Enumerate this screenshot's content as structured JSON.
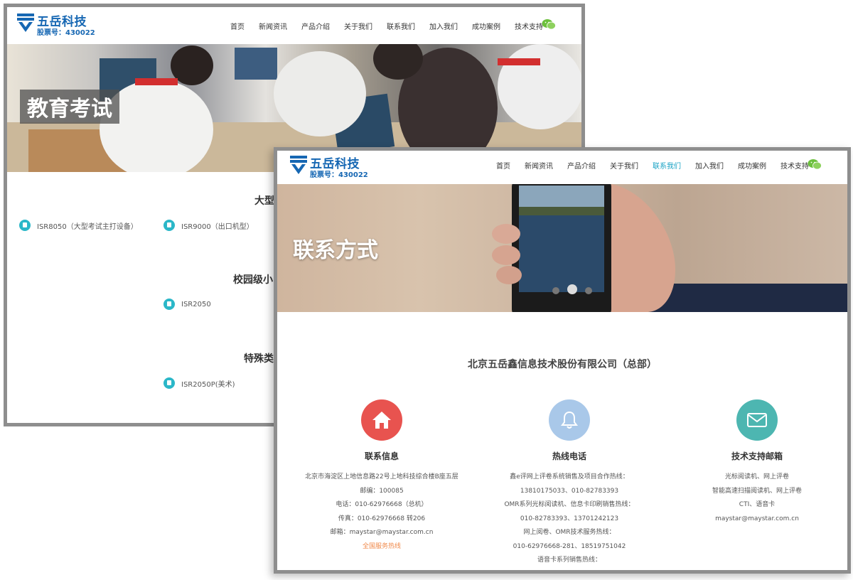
{
  "logo": {
    "name": "五岳科技",
    "stock": "股票号：430022"
  },
  "nav": [
    "首页",
    "新闻资讯",
    "产品介绍",
    "关于我们",
    "联系我们",
    "加入我们",
    "成功案例",
    "技术支持"
  ],
  "win1": {
    "banner_title": "教育考试",
    "sections": [
      "大型考",
      "校园级小",
      "特殊类"
    ],
    "products": [
      "ISR8050（大型考试主打设备）",
      "ISR9000（出口机型）",
      "ISR2050",
      "ISR2050P(美术)"
    ]
  },
  "win2": {
    "active_nav": "联系我们",
    "banner_title": "联系方式",
    "company": "北京五岳鑫信息技术股份有限公司（总部）",
    "columns": [
      {
        "icon": "home-icon",
        "color": "#e8534f",
        "title": "联系信息",
        "lines": [
          "北京市海淀区上地信息路22号上地科技综合楼B座五层",
          "邮编：100085",
          "电话：010-62976668（总机）",
          "传真：010-62976668 转206",
          "邮箱：maystar@maystar.com.cn",
          "全国服务热线"
        ]
      },
      {
        "icon": "bell-icon",
        "color": "#a9c8e9",
        "title": "热线电话",
        "lines": [
          "鑫e评网上评卷系统销售及项目合作热线：",
          "13810175033、010-82783393",
          "OMR系列光标阅读机、信息卡印刷销售热线：",
          "010-82783393、13701242123",
          "网上阅卷、OMR技术服务热线：",
          "010-62976668-281、18519751042",
          "语音卡系列销售热线："
        ]
      },
      {
        "icon": "mail-icon",
        "color": "#4db6b1",
        "title": "技术支持邮箱",
        "lines": [
          "光标阅读机、网上评卷",
          "智能高速扫描阅读机、网上评卷",
          "CTI、语音卡",
          "maystar@maystar.com.cn"
        ]
      }
    ]
  }
}
